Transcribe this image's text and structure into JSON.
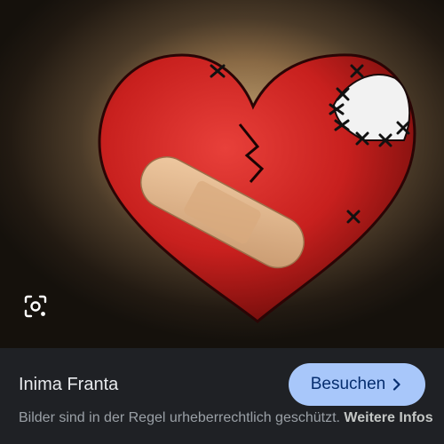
{
  "image": {
    "subject": "heart-icon",
    "colors": {
      "heart": "#c8201e",
      "patch": "#f2f2f2",
      "bandage": "#e2b48c",
      "background_glow": "#c9a978",
      "background_dark": "#15110c"
    }
  },
  "lens": {
    "icon": "lens-icon"
  },
  "panel": {
    "title": "Inima Franta",
    "visit_label": "Besuchen",
    "copyright_notice": "Bilder sind in der Regel urheberrechtlich geschützt.",
    "more_info_link": "Weitere Infos",
    "colors": {
      "background": "#1f2125",
      "button": "#a8c7fa",
      "button_text": "#062e6f"
    }
  }
}
